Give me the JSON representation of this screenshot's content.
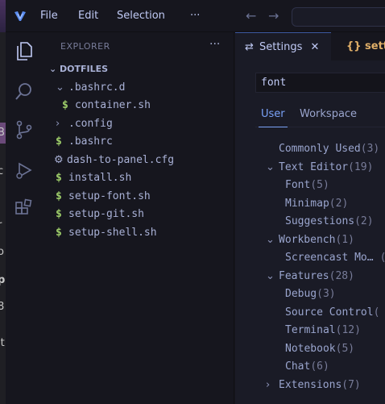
{
  "menu": {
    "file": "File",
    "edit": "Edit",
    "selection": "Selection",
    "more": "···"
  },
  "nav": {
    "back": "←",
    "forward": "→"
  },
  "explorer": {
    "title": "EXPLORER",
    "more": "···",
    "root": "DOTFILES",
    "items": [
      {
        "label": ".bashrc.d",
        "kind": "folder-open"
      },
      {
        "label": "container.sh",
        "kind": "shell"
      },
      {
        "label": ".config",
        "kind": "folder-closed"
      },
      {
        "label": ".bashrc",
        "kind": "shell"
      },
      {
        "label": "dash-to-panel.cfg",
        "kind": "gear"
      },
      {
        "label": "install.sh",
        "kind": "shell"
      },
      {
        "label": "setup-font.sh",
        "kind": "shell"
      },
      {
        "label": "setup-git.sh",
        "kind": "shell"
      },
      {
        "label": "setup-shell.sh",
        "kind": "shell"
      }
    ]
  },
  "tabs": {
    "settings": "Settings",
    "settings_close": "✕",
    "other": "{} sett"
  },
  "settings": {
    "search_value": "font",
    "scope_user": "User",
    "scope_workspace": "Workspace",
    "toc": [
      {
        "label": "Commonly Used",
        "count": "(3)"
      },
      {
        "label": "Text Editor",
        "count": "(19)"
      },
      {
        "label": "Font",
        "count": "(5)"
      },
      {
        "label": "Minimap",
        "count": "(2)"
      },
      {
        "label": "Suggestions",
        "count": "(2)"
      },
      {
        "label": "Workbench",
        "count": "(1)"
      },
      {
        "label": "Screencast Mo…",
        "count": "("
      },
      {
        "label": "Features",
        "count": "(28)"
      },
      {
        "label": "Debug",
        "count": "(3)"
      },
      {
        "label": "Source Control",
        "count": "("
      },
      {
        "label": "Terminal",
        "count": "(12)"
      },
      {
        "label": "Notebook",
        "count": "(5)"
      },
      {
        "label": "Chat",
        "count": "(6)"
      },
      {
        "label": "Extensions",
        "count": "(7)"
      }
    ]
  },
  "peek": {
    "chars": [
      "B",
      "c",
      "r",
      "o",
      "p",
      "8",
      "it"
    ]
  },
  "colors": {
    "accent": "#7aa2f7",
    "shell": "#9ece6a",
    "background": "#16161e",
    "editor": "#1a1b26"
  }
}
